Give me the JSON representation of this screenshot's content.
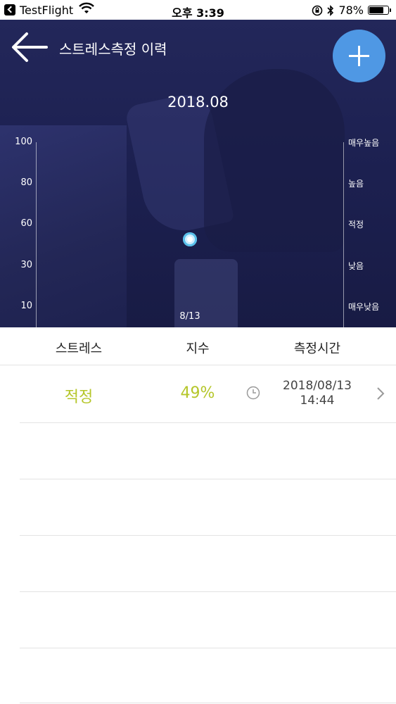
{
  "status_bar": {
    "app": "TestFlight",
    "time": "오후 3:39",
    "battery": "78%",
    "battery_level": 0.78
  },
  "header": {
    "title": "스트레스측정 이력"
  },
  "chart_data": {
    "type": "scatter",
    "title": "2018.08",
    "y_ticks_left": [
      "100",
      "80",
      "60",
      "30",
      "10"
    ],
    "y_ticks_right": [
      "매우높음",
      "높음",
      "적정",
      "낮음",
      "매우낮음"
    ],
    "x": [
      "8/13"
    ],
    "values": [
      49
    ]
  },
  "table": {
    "headers": [
      "스트레스",
      "지수",
      "측정시간"
    ],
    "rows": [
      {
        "stress": "적정",
        "index": "49%",
        "date": "2018/08/13",
        "time": "14:44"
      }
    ]
  },
  "colors": {
    "accent": "#4f98e4",
    "level_text": "#b5c62a",
    "point": "#58c0ea"
  }
}
